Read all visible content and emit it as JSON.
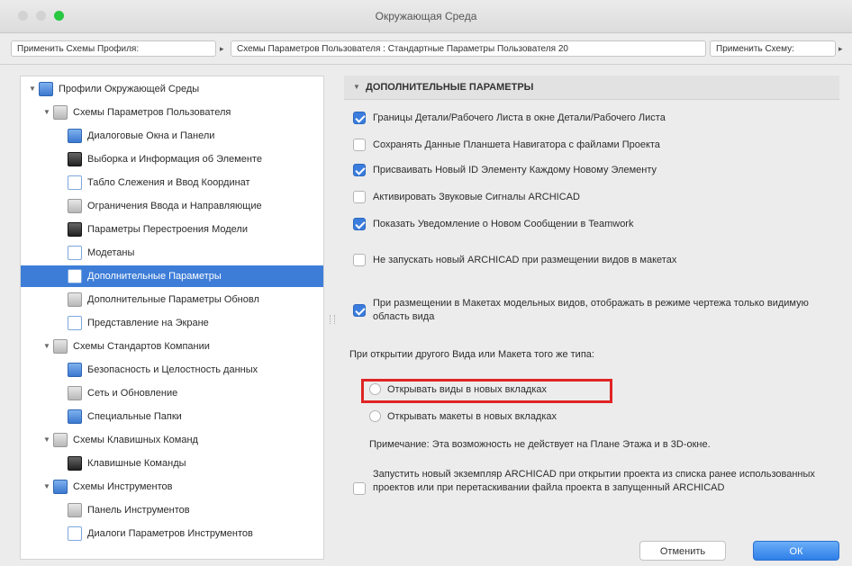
{
  "window": {
    "title": "Окружающая Среда"
  },
  "nav": {
    "apply_profile": "Применить Схемы Профиля:",
    "path": "Схемы Параметров Пользователя : Стандартные Параметры Пользователя 20",
    "apply_scheme": "Применить Схему:"
  },
  "tree": {
    "items": [
      {
        "label": "Профили Окружающей Среды",
        "level": 0,
        "expanded": true,
        "icon": "profile-icon"
      },
      {
        "label": "Схемы Параметров Пользователя",
        "level": 1,
        "expanded": true,
        "icon": "user-settings-icon"
      },
      {
        "label": "Диалоговые Окна и Панели",
        "level": 2,
        "icon": "dialogs-icon"
      },
      {
        "label": "Выборка и Информация об Элементе",
        "level": 2,
        "icon": "selection-icon"
      },
      {
        "label": "Табло Слежения и Ввод Координат",
        "level": 2,
        "icon": "tracker-icon"
      },
      {
        "label": "Ограничения Ввода и Направляющие",
        "level": 2,
        "icon": "constraints-icon"
      },
      {
        "label": "Параметры Перестроения Модели",
        "level": 2,
        "icon": "rebuild-icon"
      },
      {
        "label": "Модетаны",
        "level": 2,
        "icon": "modules-icon"
      },
      {
        "label": "Дополнительные Параметры",
        "level": 2,
        "selected": true,
        "icon": "more-options-icon"
      },
      {
        "label": "Дополнительные Параметры Обновл",
        "level": 2,
        "icon": "update-icon"
      },
      {
        "label": "Представление на Экране",
        "level": 2,
        "icon": "display-icon"
      },
      {
        "label": "Схемы Стандартов Компании",
        "level": 1,
        "expanded": true,
        "icon": "company-standards-icon"
      },
      {
        "label": "Безопасность и Целостность данных",
        "level": 2,
        "icon": "security-icon"
      },
      {
        "label": "Сеть и Обновление",
        "level": 2,
        "icon": "network-icon"
      },
      {
        "label": "Специальные Папки",
        "level": 2,
        "icon": "folders-icon"
      },
      {
        "label": "Схемы Клавишных Команд",
        "level": 1,
        "expanded": true,
        "icon": "shortcuts-icon"
      },
      {
        "label": "Клавишные Команды",
        "level": 2,
        "icon": "keyboard-icon"
      },
      {
        "label": "Схемы Инструментов",
        "level": 1,
        "expanded": true,
        "icon": "tools-scheme-icon"
      },
      {
        "label": "Панель Инструментов",
        "level": 2,
        "icon": "toolbar-icon"
      },
      {
        "label": "Диалоги Параметров Инструментов",
        "level": 2,
        "icon": "tool-settings-icon"
      }
    ]
  },
  "section": {
    "title": "ДОПОЛНИТЕЛЬНЫЕ ПАРАМЕТРЫ"
  },
  "options": [
    {
      "label": "Границы Детали/Рабочего Листа в окне Детали/Рабочего Листа",
      "checked": true
    },
    {
      "label": "Сохранять Данные Планшета Навигатора с файлами Проекта",
      "checked": false
    },
    {
      "label": "Присваивать Новый ID Элементу Каждому Новому Элементу",
      "checked": true
    },
    {
      "label": "Активировать Звуковые Сигналы ARCHICAD",
      "checked": false
    },
    {
      "label": "Показать Уведомление о Новом Сообщении в Teamwork",
      "checked": true
    },
    {
      "label": "Не запускать новый ARCHICAD при размещении видов в макетах",
      "checked": false
    },
    {
      "label": "При размещении в Макетах модельных видов, отображать в режиме чертежа только видимую область вида",
      "checked": true
    }
  ],
  "open_group": {
    "label": "При открытии другого Вида или Макета того же типа:",
    "open_views": "Открывать виды в новых вкладках",
    "open_layouts": "Открывать макеты в новых вкладках",
    "note": "Примечание: Эта возможность не действует на Плане Этажа и в 3D-окне."
  },
  "last_option": {
    "label": "Запустить новый экземпляр ARCHICAD при открытии проекта из списка ранее использованных проектов или при перетаскивании файла проекта в запущенный ARCHICAD",
    "checked": false
  },
  "buttons": {
    "cancel": "Отменить",
    "ok": "ОК"
  },
  "colors": {
    "selection": "#3d7dd8",
    "highlight": "#e02424",
    "ok": "#2f7fe8"
  }
}
